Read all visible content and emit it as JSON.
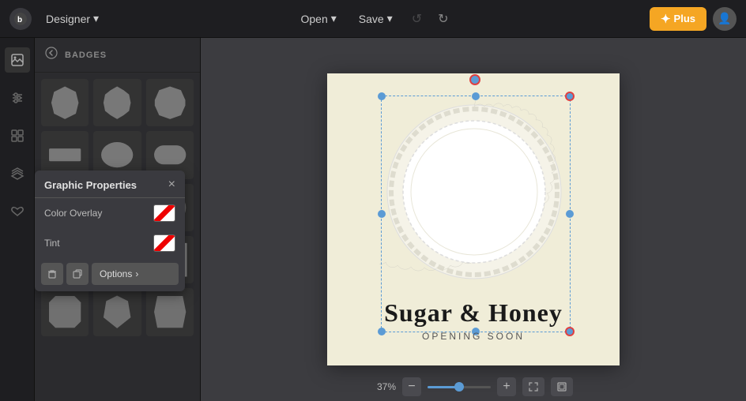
{
  "topbar": {
    "app_name": "Designer",
    "open_label": "Open",
    "save_label": "Save",
    "plus_label": "Plus",
    "chevron": "▾"
  },
  "panel": {
    "back_icon": "‹",
    "title": "BADGES",
    "close_icon": "×"
  },
  "graphic_props": {
    "title": "Graphic Properties",
    "close_icon": "×",
    "color_overlay_label": "Color Overlay",
    "tint_label": "Tint",
    "options_btn_label": "Options",
    "options_chevron": "›"
  },
  "canvas": {
    "main_text": "Sugar & Honey",
    "sub_text": "OPENING SOON",
    "zoom_level": "37%"
  },
  "sidebar": {
    "items": [
      {
        "icon": "🖼",
        "name": "images"
      },
      {
        "icon": "◀",
        "name": "back"
      },
      {
        "icon": "⊞",
        "name": "layout"
      },
      {
        "icon": "▤",
        "name": "layers"
      },
      {
        "icon": "♡",
        "name": "favorites"
      }
    ]
  }
}
